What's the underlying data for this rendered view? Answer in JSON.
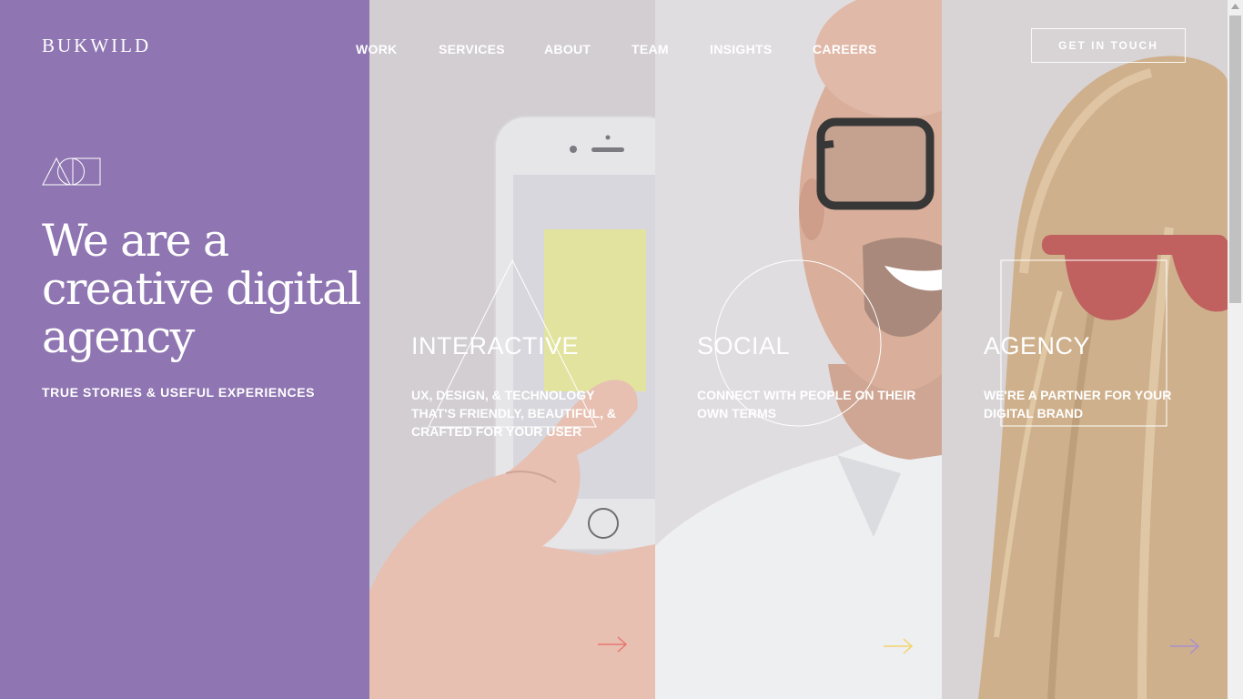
{
  "brand": {
    "logo_text": "BUKWILD"
  },
  "nav": {
    "items": [
      {
        "key": "work",
        "label": "WORK"
      },
      {
        "key": "services",
        "label": "SERVICES"
      },
      {
        "key": "about",
        "label": "ABOUT"
      },
      {
        "key": "team",
        "label": "TEAM"
      },
      {
        "key": "insights",
        "label": "INSIGHTS"
      },
      {
        "key": "careers",
        "label": "CAREERS"
      }
    ],
    "cta_label": "GET IN TOUCH"
  },
  "hero": {
    "headline": "We are a creative digital agency",
    "tagline": "TRUE STORIES & USEFUL EXPERIENCES",
    "background_color": "#8f76b2",
    "icon": "triangle-circle-square-icon"
  },
  "panels": [
    {
      "key": "interactive",
      "title": "INTERACTIVE",
      "description": "UX, DESIGN, & TECHNOLOGY THAT'S FRIENDLY, BEAUTIFUL, & CRAFTED FOR YOUR USER",
      "overlay_shape": "triangle",
      "arrow_color": "#e8756f",
      "image": "hand-holding-smartphone"
    },
    {
      "key": "social",
      "title": "SOCIAL",
      "description": "CONNECT WITH PEOPLE ON THEIR OWN TERMS",
      "overlay_shape": "circle",
      "arrow_color": "#f3d36b",
      "image": "smiling-man-with-glasses"
    },
    {
      "key": "agency",
      "title": "AGENCY",
      "description": "WE'RE A PARTNER FOR YOUR DIGITAL BRAND",
      "overlay_shape": "square",
      "arrow_color": "#a98fd0",
      "image": "woman-with-red-sunglasses-on-back-of-head"
    }
  ]
}
